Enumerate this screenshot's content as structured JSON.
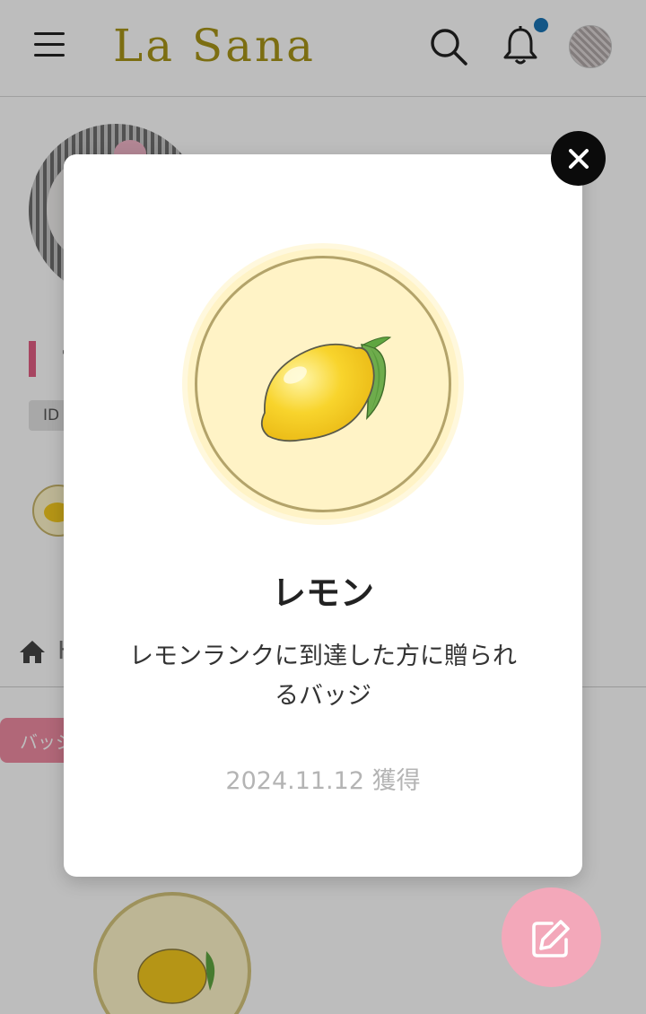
{
  "header": {
    "logo": "La Sana",
    "icons": [
      "hamburger-icon",
      "search-icon",
      "bell-icon",
      "avatar"
    ],
    "notification_dot_color": "#1a75b5"
  },
  "profile": {
    "name_partial": "フ",
    "id_label": "ID",
    "nav_partial": "H",
    "badge_tab_partial": "バッジ"
  },
  "modal": {
    "badge_icon": "lemon-icon",
    "title": "レモン",
    "description": "レモンランクに到達した方に贈られるバッジ",
    "date": "2024.11.12 獲得"
  },
  "colors": {
    "brand": "#a89519",
    "accent_pink": "#ef8ba3",
    "fab": "#f3a8ba",
    "badge_bg": "#fff3c6"
  },
  "fab": {
    "icon": "edit-icon"
  }
}
